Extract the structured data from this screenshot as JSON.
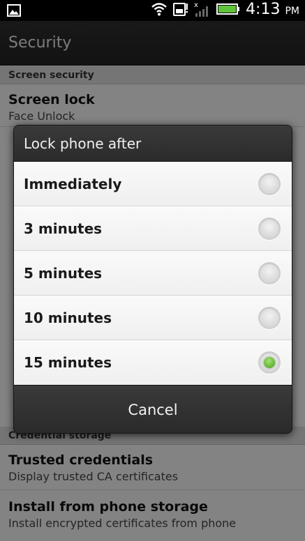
{
  "status_bar": {
    "time": "4:13",
    "ampm": "PM",
    "icons": [
      "image-notification-icon",
      "wifi-icon",
      "sim-card-icon",
      "signal-no-service-icon",
      "battery-icon"
    ],
    "battery_color": "#5fc43a"
  },
  "action_bar": {
    "title": "Security"
  },
  "settings": {
    "screen_security_header": "Screen security",
    "screen_lock_title": "Screen lock",
    "screen_lock_subtitle": "Face Unlock",
    "credential_storage_header": "Credential storage",
    "trusted_credentials_title": "Trusted credentials",
    "trusted_credentials_subtitle": "Display trusted CA certificates",
    "install_title": "Install from phone storage",
    "install_subtitle": "Install encrypted certificates from phone"
  },
  "dialog": {
    "title": "Lock phone after",
    "options": [
      {
        "label": "Immediately",
        "selected": false
      },
      {
        "label": "3 minutes",
        "selected": false
      },
      {
        "label": "5 minutes",
        "selected": false
      },
      {
        "label": "10 minutes",
        "selected": false
      },
      {
        "label": "15 minutes",
        "selected": true
      }
    ],
    "cancel_label": "Cancel",
    "accent_color": "#6cbf3c"
  }
}
